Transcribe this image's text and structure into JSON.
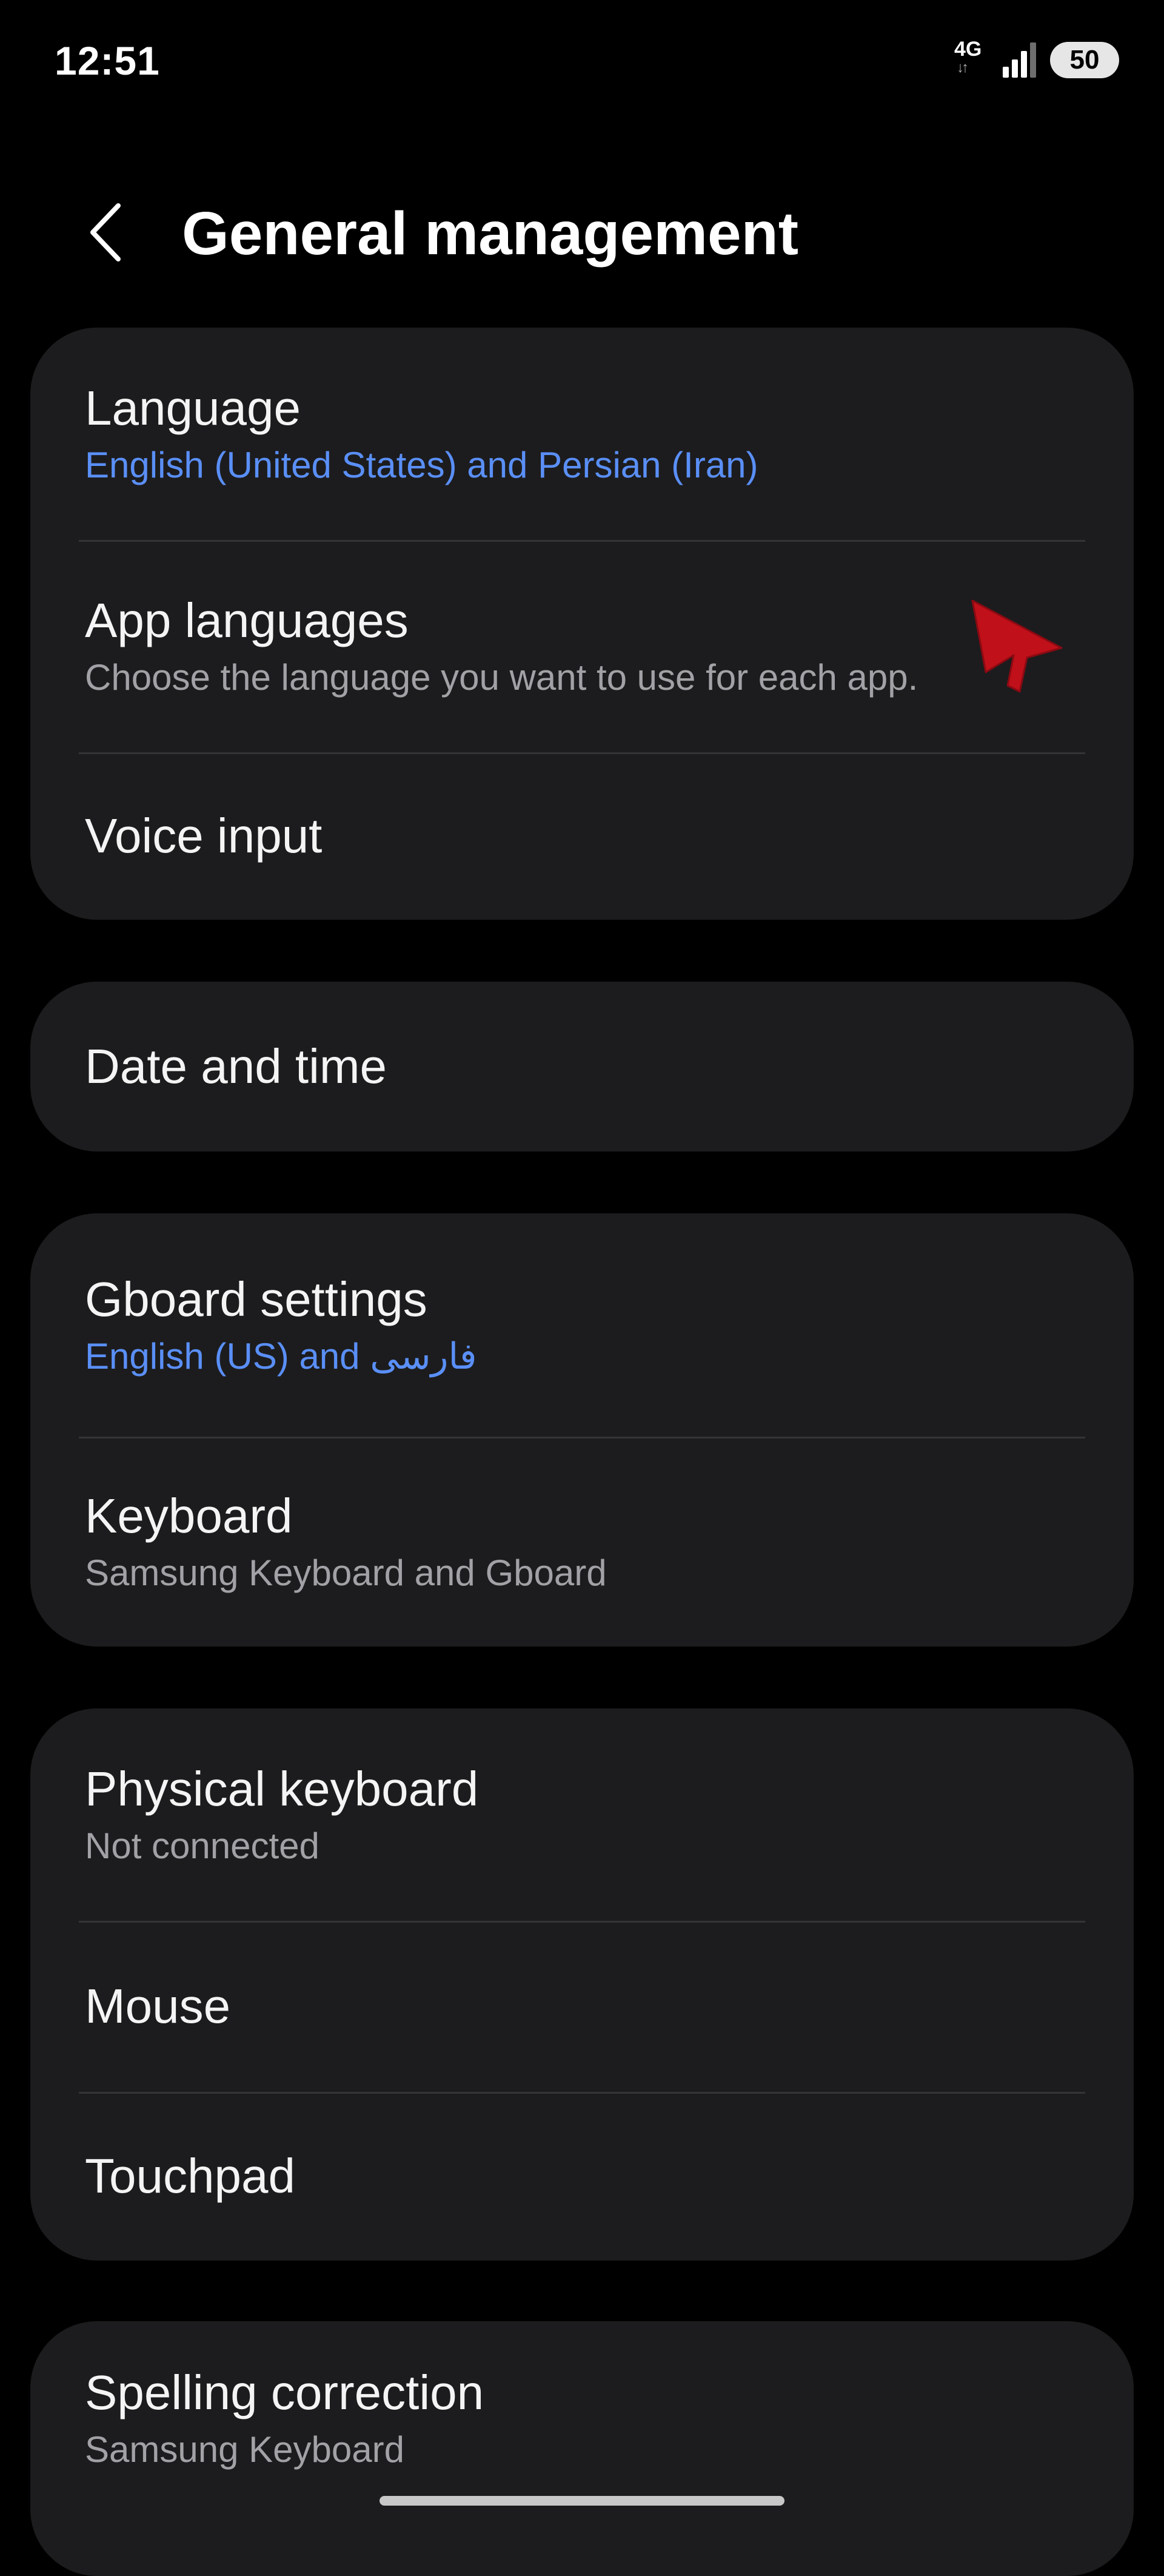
{
  "status_bar": {
    "time": "12:51",
    "network_type": "4G",
    "network_arrows": "↓↑",
    "battery_level": "50",
    "icons": [
      "signal-bars-icon"
    ]
  },
  "header": {
    "back_icon": "chevron-left-icon",
    "title": "General management"
  },
  "groups": [
    {
      "items": [
        {
          "title": "Language",
          "subtitle": "English (United States) and Persian (Iran)",
          "subtitle_style": "accent"
        },
        {
          "title": "App languages",
          "subtitle": "Choose the language you want to use for each app.",
          "subtitle_style": "muted"
        },
        {
          "title": "Voice input"
        }
      ]
    },
    {
      "items": [
        {
          "title": "Date and time"
        }
      ]
    },
    {
      "items": [
        {
          "title": "Gboard settings",
          "subtitle": "English (US) and فارسی",
          "subtitle_style": "accent"
        },
        {
          "title": "Keyboard",
          "subtitle": "Samsung Keyboard and Gboard",
          "subtitle_style": "muted"
        }
      ]
    },
    {
      "items": [
        {
          "title": "Physical keyboard",
          "subtitle": "Not connected",
          "subtitle_style": "muted"
        },
        {
          "title": "Mouse"
        },
        {
          "title": "Touchpad"
        }
      ]
    },
    {
      "items": [
        {
          "title": "Spelling correction",
          "subtitle": "Samsung Keyboard",
          "subtitle_style": "muted"
        }
      ]
    }
  ],
  "colors": {
    "background": "#000000",
    "card": "#1c1c1e",
    "accent_text": "#5a8ff7",
    "muted_text": "#a2a2a6",
    "cursor": "#c0101a"
  },
  "overlay": {
    "cursor_icon": "mouse-pointer-icon"
  }
}
